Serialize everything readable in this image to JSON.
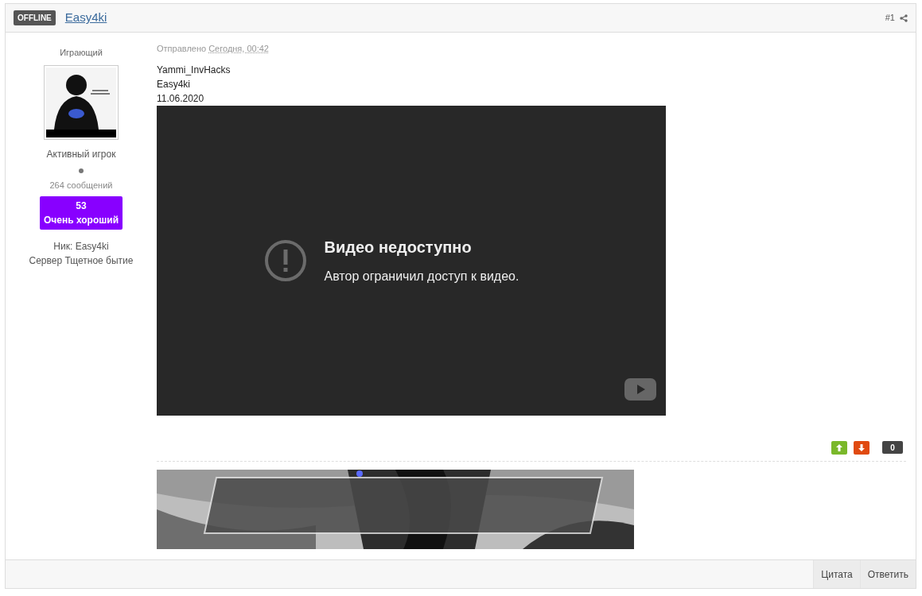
{
  "header": {
    "status_badge": "OFFLINE",
    "author": "Easy4ki",
    "post_number": "#1"
  },
  "user": {
    "title": "Играющий",
    "rank": "Активный игрок",
    "posts": "264 сообщений",
    "reputation": {
      "value": "53",
      "label": "Очень хороший",
      "color": "#8800ff"
    },
    "fields": [
      {
        "label": "Ник:",
        "value": "Easy4ki"
      },
      {
        "label": "Сервер",
        "value": "Тщетное бытие"
      }
    ]
  },
  "post": {
    "sent_label": "Отправлено",
    "sent_time": "Сегодня, 00:42",
    "lines": [
      "Yammi_InvHacks",
      "Easy4ki",
      "11.06.2020"
    ],
    "video": {
      "title": "Видео недоступно",
      "message": "Автор ограничил доступ к видео."
    },
    "votes": {
      "score": "0"
    }
  },
  "footer": {
    "buttons": [
      "Цитата",
      "Ответить"
    ]
  }
}
